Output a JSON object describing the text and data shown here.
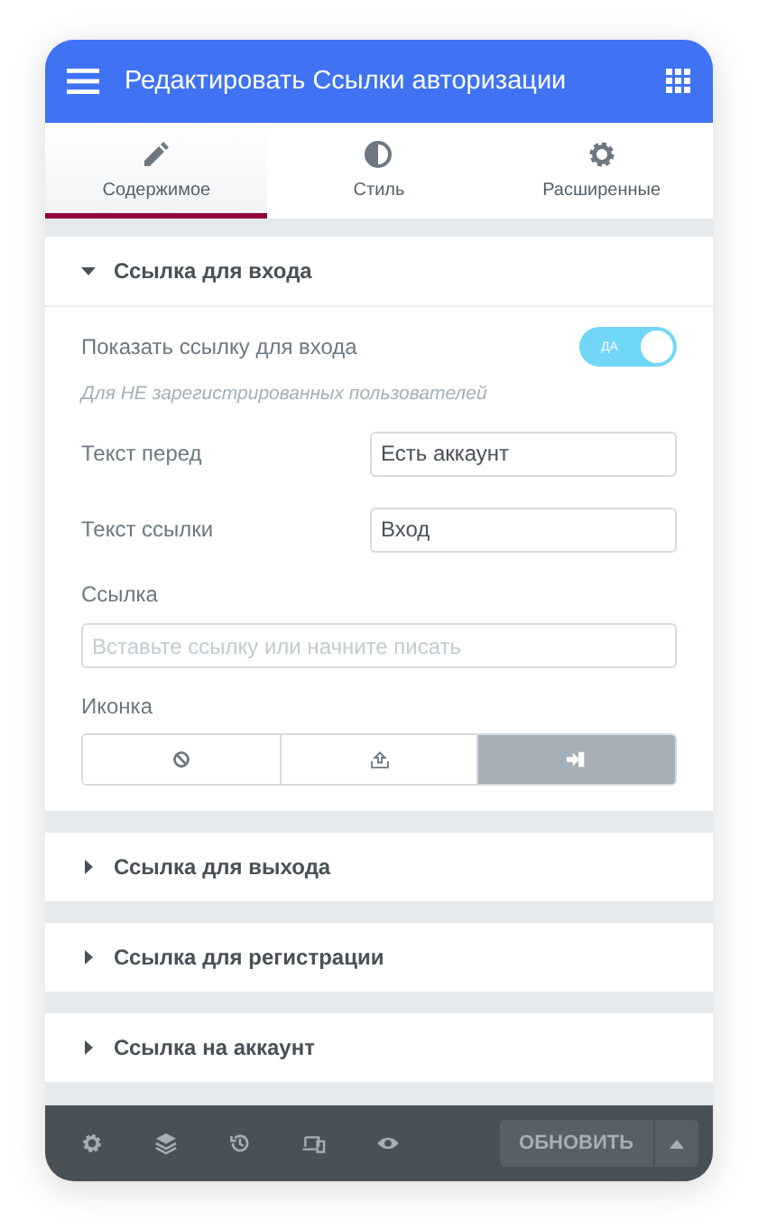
{
  "header": {
    "title": "Редактировать Ссылки авторизации"
  },
  "tabs": [
    {
      "label": "Содержимое",
      "kind": "pencil",
      "selected": true
    },
    {
      "label": "Стиль",
      "kind": "contrast",
      "selected": false
    },
    {
      "label": "Расширенные",
      "kind": "gear",
      "selected": false
    }
  ],
  "sections": [
    {
      "title": "Ссылка для входа",
      "expanded": true,
      "toggle": {
        "label": "Показать ссылку для входа",
        "on": true,
        "state_text": "ДА"
      },
      "note": "Для НЕ зарегистрированных пользователей",
      "fields": [
        {
          "label": "Текст перед",
          "value": "Есть аккаунт"
        },
        {
          "label": "Текст ссылки",
          "value": "Вход"
        }
      ],
      "link": {
        "label": "Ссылка",
        "placeholder": "Вставьте ссылку или начните писать"
      },
      "icon_choice": {
        "label": "Иконка",
        "options": [
          {
            "kind": "none",
            "selected": false
          },
          {
            "kind": "upload",
            "selected": false
          },
          {
            "kind": "signin",
            "selected": true
          }
        ]
      }
    },
    {
      "title": "Ссылка для выхода",
      "expanded": false
    },
    {
      "title": "Ссылка для регистрации",
      "expanded": false
    },
    {
      "title": "Ссылка на аккаунт",
      "expanded": false
    }
  ],
  "footer": {
    "update_button": "ОБНОВИТЬ"
  }
}
